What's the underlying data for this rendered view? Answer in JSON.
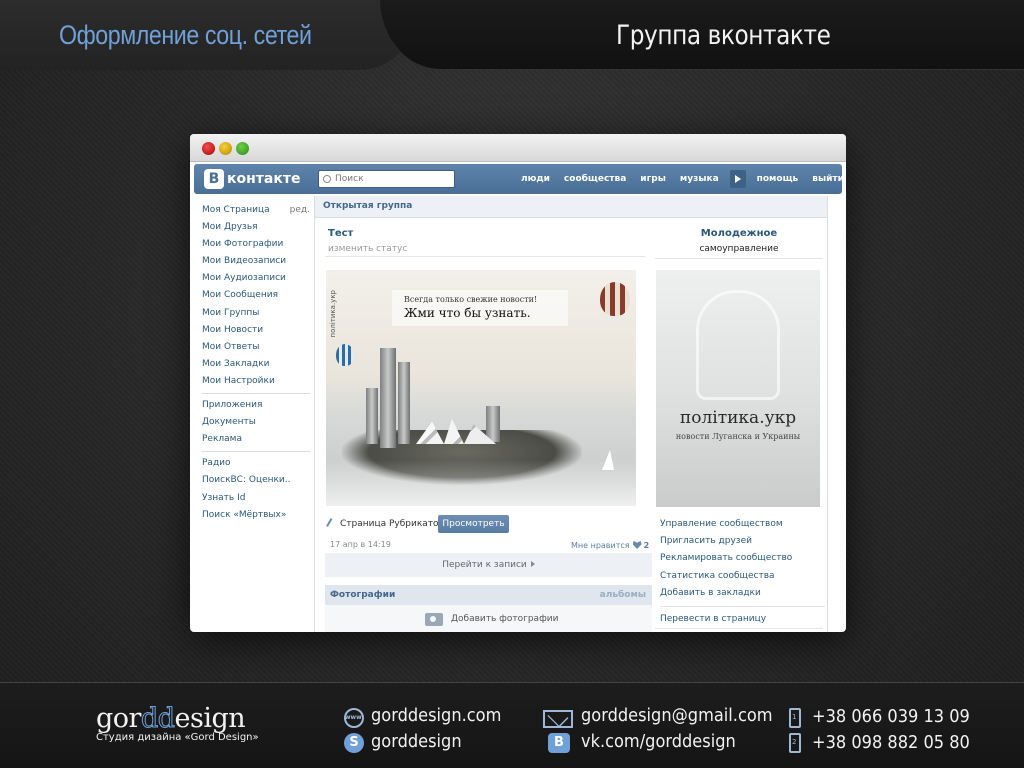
{
  "header": {
    "left_title": "Оформление соц. сетей",
    "right_title": "Группа вконтакте"
  },
  "vk": {
    "logo_letter": "В",
    "logo_word": "контакте",
    "search_placeholder": "Поиск",
    "nav": [
      "люди",
      "сообщества",
      "игры",
      "музыка",
      "помощь",
      "выйти"
    ],
    "left_menu": {
      "group1": [
        "Моя Страница",
        "Мои Друзья",
        "Мои Фотографии",
        "Мои Видеозаписи",
        "Мои Аудиозаписи",
        "Мои Сообщения",
        "Мои Группы",
        "Мои Новости",
        "Мои Ответы",
        "Мои Закладки",
        "Мои Настройки"
      ],
      "edit": "ред.",
      "group2": [
        "Приложения",
        "Документы",
        "Реклама"
      ],
      "group3": [
        "Радио",
        "ПоискВС: Оценки..",
        "Узнать Id",
        "Поиск «Мёртвых»"
      ]
    },
    "content": {
      "header": "Открытая группа",
      "group_name": "Тест",
      "status": "изменить статус",
      "banner": {
        "brand_vertical": "політика.укр",
        "line1": "Всегда только свежие новости!",
        "line2": "Жми что бы узнать."
      },
      "rubric_label": "Страница Рубрикатор",
      "view_button": "Просмотреть",
      "post_date": "17 апр в 14:19",
      "likes_label": "Мне нравится",
      "likes_count": "2",
      "goto_label": "Перейти к записи",
      "photos_title": "Фотографии",
      "albums_link": "альбомы",
      "add_photos": "Добавить фотографии"
    },
    "right_column": {
      "title": "Молодежное",
      "subtitle": "самоуправление",
      "brand": "політика.укр",
      "brand_sub": "новости Луганска и Украины",
      "menu1": [
        "Управление сообществом",
        "Пригласить друзей",
        "Рекламировать сообщество",
        "Статистика сообщества",
        "Добавить в закладки"
      ],
      "menu2": [
        "Перевести в страницу"
      ]
    }
  },
  "footer": {
    "logo_start": "gor",
    "logo_dd": "dd",
    "logo_end": "esign",
    "logo_sub": "Студия дизайна «Gord Design»",
    "website": "gorddesign.com",
    "skype": "gorddesign",
    "email": "gorddesign@gmail.com",
    "vk": "vk.com/gorddesign",
    "phone1": "+38 066 039 13 09",
    "phone2": "+38 098 882 05 80",
    "phone1_badge": "1",
    "phone2_badge": "2"
  }
}
